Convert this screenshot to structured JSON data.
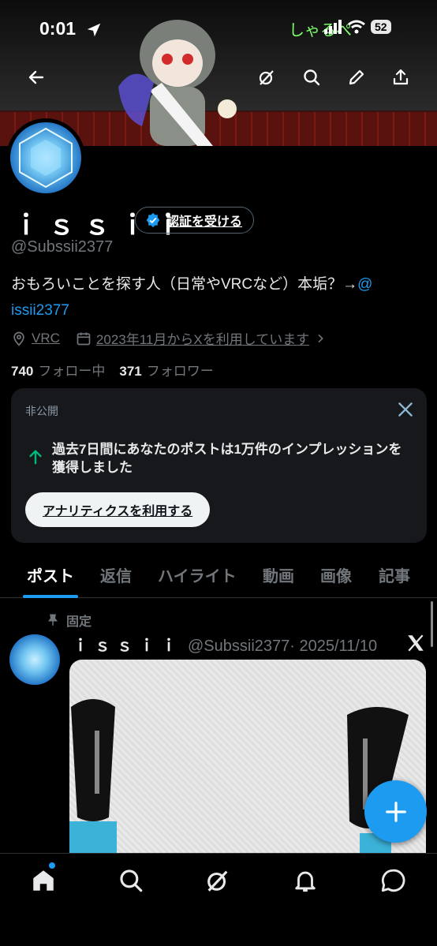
{
  "status_bar": {
    "time": "0:01",
    "battery": "52",
    "overlay_text": "しゃるぺ"
  },
  "header": {
    "back_icon": "back-arrow-icon",
    "actions": [
      "grok-icon",
      "search-icon",
      "edit-icon",
      "share-icon"
    ]
  },
  "profile": {
    "name": "ｉｓｓｉｉ",
    "verify_label": "認証を受ける",
    "handle": "@Subssii2377",
    "bio_text": "おもろいことを探す人（日常やVRCなど）本垢？→",
    "bio_mention": "@ issii2377",
    "location": "VRC",
    "joined": "2023年11月からXを利用しています",
    "following_count": "740",
    "following_label": "フォロー中",
    "followers_count": "371",
    "followers_label": "フォロワー"
  },
  "private_card": {
    "label": "非公開",
    "message": "過去7日間にあなたのポストは1万件のインプレッションを獲得しました",
    "button_label": "アナリティクスを利用する"
  },
  "tabs": [
    "ポスト",
    "返信",
    "ハイライト",
    "動画",
    "画像",
    "記事"
  ],
  "active_tab": "ポスト",
  "post": {
    "pinned_label": "固定",
    "author_name": "ｉｓｓｉｉ",
    "author_handle": "@Subssii2377",
    "date": "· 2025/11/10"
  },
  "bottom_nav": [
    "home-icon",
    "search-icon",
    "grok-icon",
    "notifications-icon",
    "messages-icon"
  ],
  "colors": {
    "accent": "#1d9bf0",
    "background": "#000000",
    "card": "#16181c",
    "muted": "#71767b"
  }
}
